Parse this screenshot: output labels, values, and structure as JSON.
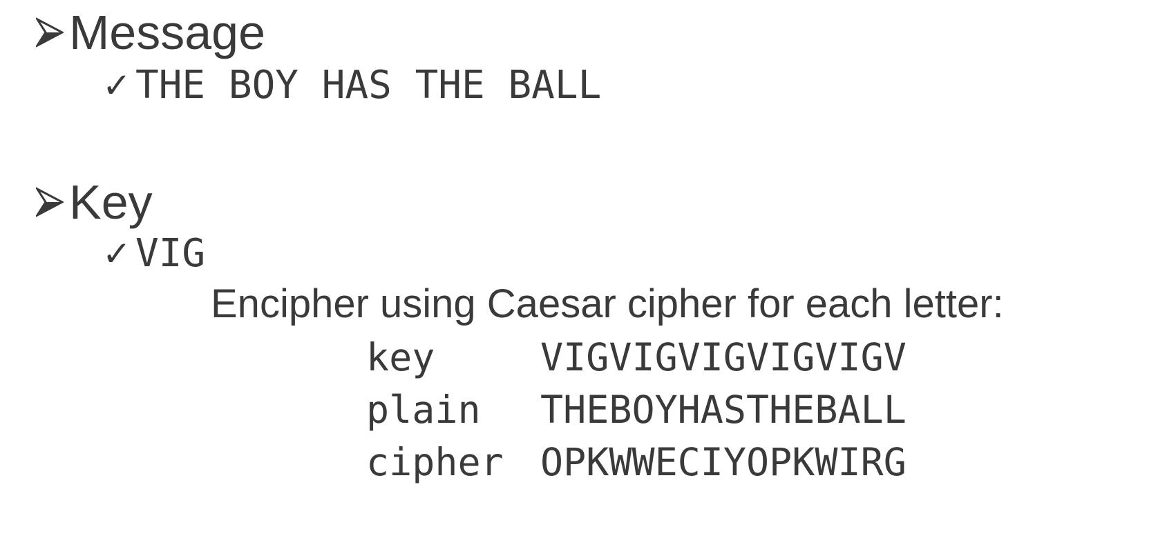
{
  "sections": [
    {
      "heading": "Message",
      "item": "THE BOY HAS THE BALL"
    },
    {
      "heading": "Key",
      "item": "VIG"
    }
  ],
  "instruction": "Encipher using Caesar cipher for each letter:",
  "table": [
    {
      "label": "key",
      "value": "VIGVIGVIGVIGVIGV"
    },
    {
      "label": "plain",
      "value": "THEBOYHASTHEBALL"
    },
    {
      "label": "cipher",
      "value": "OPKWWECIYOPKWIRG"
    }
  ],
  "icons": {
    "bullet": "arrowhead-bullet-icon",
    "subbullet": "checkmark-icon"
  },
  "colors": {
    "text": "#3a3a3a",
    "background": "#ffffff"
  }
}
